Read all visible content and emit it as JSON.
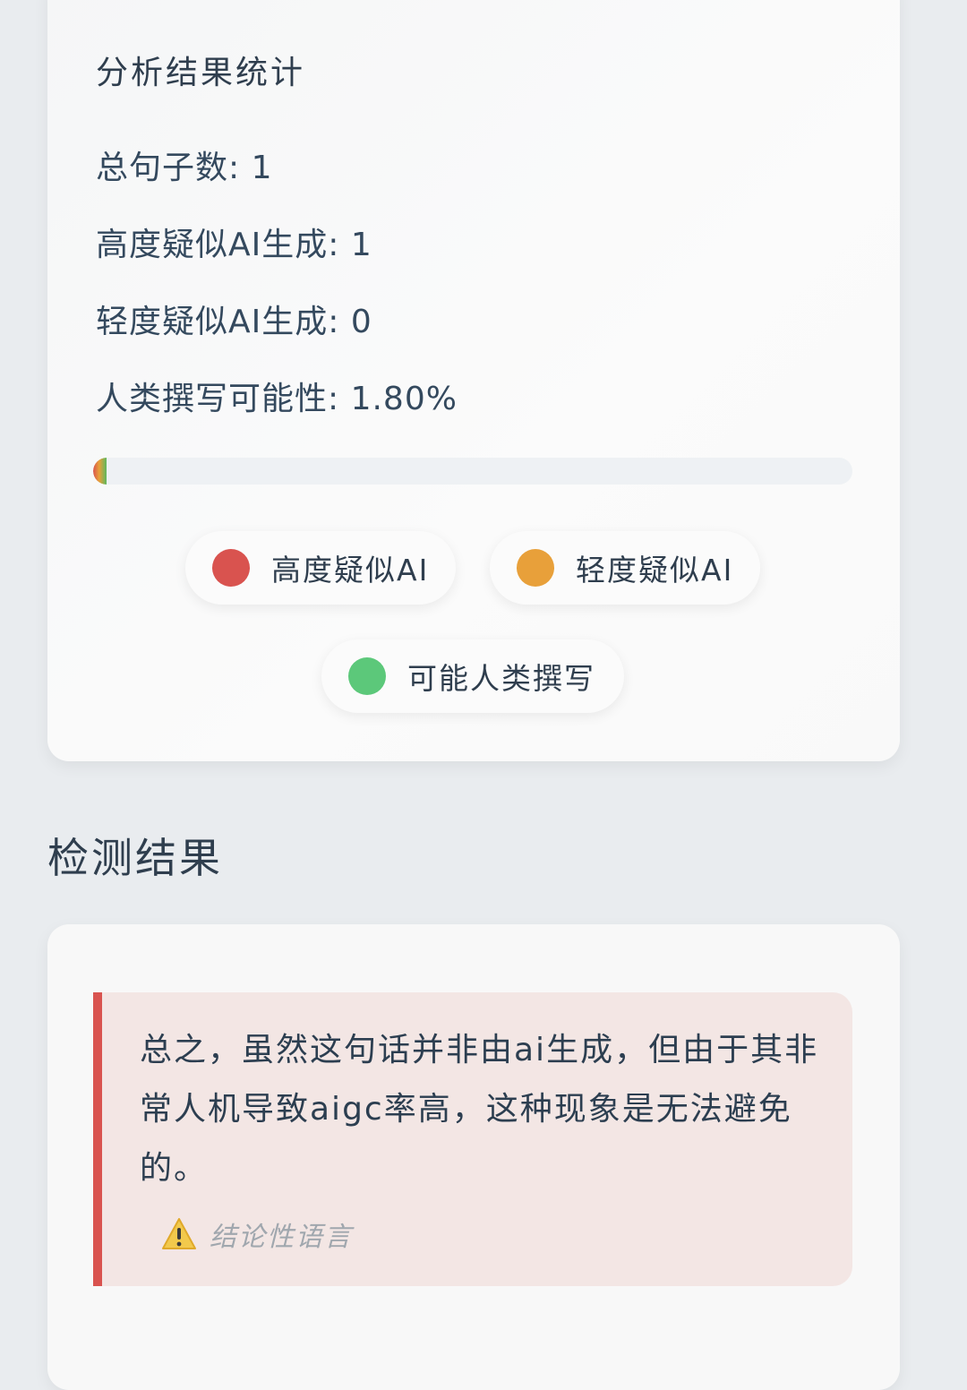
{
  "stats": {
    "title": "分析结果统计",
    "total_sentences": "总句子数: 1",
    "high_ai": "高度疑似AI生成: 1",
    "low_ai": "轻度疑似AI生成: 0",
    "human_probability": "人类撰写可能性: 1.80%",
    "progress_fraction": 0.018
  },
  "legend": {
    "high": {
      "label": "高度疑似AI",
      "color": "#d9534f"
    },
    "low": {
      "label": "轻度疑似AI",
      "color": "#e8a03a"
    },
    "human": {
      "label": "可能人类撰写",
      "color": "#5cc87a"
    }
  },
  "results": {
    "title": "检测结果",
    "items": [
      {
        "text": "总之，虽然这句话并非由ai生成，但由于其非常人机导致aigc率高，这种现象是无法避免的。",
        "tag": "结论性语言",
        "tag_icon": "warning-icon",
        "accent": "#d9534f"
      }
    ]
  }
}
